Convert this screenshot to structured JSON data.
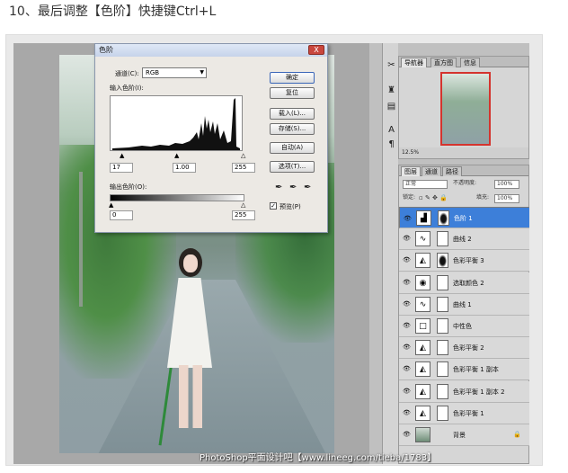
{
  "heading": "10、最后调整【色阶】快捷键Ctrl+L",
  "levels_dialog": {
    "title": "色阶",
    "close": "X",
    "channel_label": "通道(C):",
    "channel_value": "RGB",
    "input_levels_label": "输入色阶(I):",
    "input_black": "17",
    "input_gamma": "1.00",
    "input_white": "255",
    "output_levels_label": "输出色阶(O):",
    "output_black": "0",
    "output_white": "255",
    "buttons": {
      "ok": "确定",
      "reset": "复位",
      "load": "载入(L)...",
      "save": "存储(S)...",
      "auto": "自动(A)",
      "options": "选项(T)..."
    },
    "preview_label": "预览(P)",
    "preview_checked": true
  },
  "navigator": {
    "tabs": [
      "导航器",
      "直方图",
      "信息"
    ],
    "zoom": "12.5%"
  },
  "layers_panel": {
    "tabs": [
      "图层",
      "通道",
      "路径"
    ],
    "blend_mode": "正常",
    "opacity_label": "不透明度:",
    "opacity_value": "100%",
    "lock_label": "锁定:",
    "fill_label": "填充:",
    "fill_value": "100%",
    "layers": [
      {
        "name": "色阶 1",
        "selected": true,
        "thumb": "levels-icon",
        "mask": "dark"
      },
      {
        "name": "曲线 2",
        "selected": false,
        "thumb": "curves-icon",
        "mask": "white"
      },
      {
        "name": "色彩平衡 3",
        "selected": false,
        "thumb": "color-balance-icon",
        "mask": "dark"
      },
      {
        "name": "选取颜色 2",
        "selected": false,
        "thumb": "selective-color-icon",
        "mask": "white"
      },
      {
        "name": "曲线 1",
        "selected": false,
        "thumb": "curves-icon",
        "mask": "white"
      },
      {
        "name": "中性色",
        "selected": false,
        "thumb": "gray-fill-icon",
        "mask": "white"
      },
      {
        "name": "色彩平衡 2",
        "selected": false,
        "thumb": "color-balance-icon",
        "mask": "white"
      },
      {
        "name": "色彩平衡 1 副本",
        "selected": false,
        "thumb": "color-balance-icon",
        "mask": "white"
      },
      {
        "name": "色彩平衡 1 副本 2",
        "selected": false,
        "thumb": "color-balance-icon",
        "mask": "white"
      },
      {
        "name": "色彩平衡 1",
        "selected": false,
        "thumb": "color-balance-icon",
        "mask": "white"
      },
      {
        "name": "背景",
        "selected": false,
        "thumb": "photo-thumb",
        "mask": "none",
        "locked": true
      }
    ]
  },
  "watermark": "PhotoShop平面设计吧【www.lineeg.com/tieba/1783】"
}
